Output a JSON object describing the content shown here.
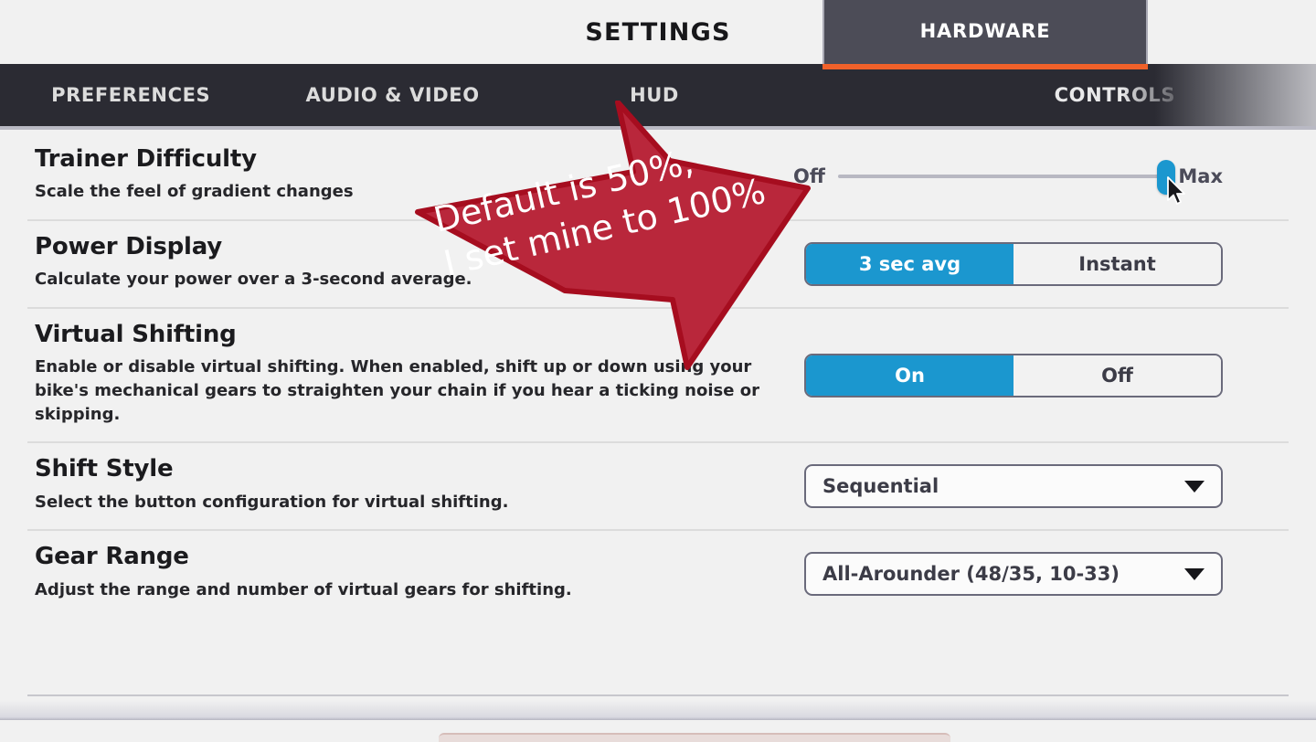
{
  "header": {
    "title": "SETTINGS"
  },
  "tabs": [
    {
      "label": "PREFERENCES",
      "active": false
    },
    {
      "label": "AUDIO & VIDEO",
      "active": false
    },
    {
      "label": "HUD",
      "active": false
    },
    {
      "label": "HARDWARE",
      "active": true
    },
    {
      "label": "CONTROLS",
      "active": false
    }
  ],
  "active_tab": "HARDWARE",
  "settings": [
    {
      "title": "Trainer Difficulty",
      "desc": "Scale the feel of gradient changes",
      "control": "slider",
      "slider": {
        "min_label": "Off",
        "max_label": "Max",
        "value_percent": 100
      }
    },
    {
      "title": "Power Display",
      "desc": "Calculate your power over a 3-second average.",
      "control": "segmented",
      "segments": [
        {
          "label": "3 sec avg",
          "selected": true
        },
        {
          "label": "Instant",
          "selected": false
        }
      ]
    },
    {
      "title": "Virtual Shifting",
      "desc": "Enable or disable virtual shifting. When enabled, shift up or down using your bike's mechanical gears to straighten your chain if you hear a ticking noise or skipping.",
      "control": "segmented",
      "segments": [
        {
          "label": "On",
          "selected": true
        },
        {
          "label": "Off",
          "selected": false
        }
      ]
    },
    {
      "title": "Shift Style",
      "desc": "Select the button configuration for virtual shifting.",
      "control": "dropdown",
      "dropdown": {
        "value": "Sequential"
      }
    },
    {
      "title": "Gear Range",
      "desc": "Adjust the range and number of virtual gears for shifting.",
      "control": "dropdown",
      "dropdown": {
        "value": "All-Arounder (48/35, 10-33)"
      }
    }
  ],
  "annotation": {
    "line1": "Default is 50%,",
    "line2": "I set mine to 100%",
    "text": "Default is 50%,\nI set mine to 100%",
    "fill_color": "#b9273b",
    "stroke_color": "#a60d1f",
    "text_color": "#ffffff"
  },
  "colors": {
    "page_background": "#f1f1f1",
    "tabbar_background": "#2b2b33",
    "active_tab_background": "#4c4c57",
    "accent_orange": "#f0612a",
    "accent_blue": "#1b97cf",
    "control_border": "#6a6a7b"
  }
}
